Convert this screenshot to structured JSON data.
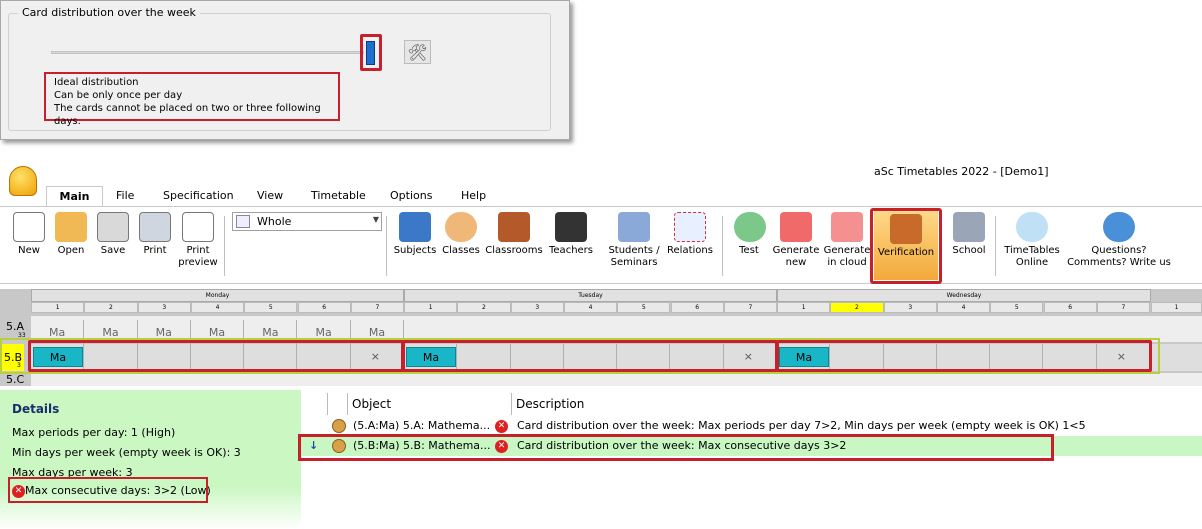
{
  "dialog": {
    "group_title": "Card distribution over the week",
    "description_lines": [
      "Ideal distribution",
      "Can be only once per day",
      "The cards cannot be placed on two or three following days."
    ]
  },
  "app": {
    "title": "aSc Timetables 2022  - [Demo1]"
  },
  "menu": {
    "items": [
      "Main",
      "File",
      "Specification",
      "View",
      "Timetable",
      "Options",
      "Help"
    ]
  },
  "ribbon": {
    "buttons": [
      {
        "label": "New",
        "icon": "new-document-icon"
      },
      {
        "label": "Open",
        "icon": "folder-icon"
      },
      {
        "label": "Save",
        "icon": "save-icon"
      },
      {
        "label": "Print",
        "icon": "print-icon"
      },
      {
        "label": "Print preview",
        "icon": "print-preview-icon"
      },
      {
        "label": "Subjects",
        "icon": "book-icon"
      },
      {
        "label": "Classes",
        "icon": "classes-icon"
      },
      {
        "label": "Classrooms",
        "icon": "door-icon"
      },
      {
        "label": "Teachers",
        "icon": "teacher-icon"
      },
      {
        "label": "Students / Seminars",
        "icon": "students-icon"
      },
      {
        "label": "Relations",
        "icon": "relations-icon"
      },
      {
        "label": "Test",
        "icon": "check-icon"
      },
      {
        "label": "Generate new",
        "icon": "siren-icon"
      },
      {
        "label": "Generate in cloud",
        "icon": "siren-cloud-icon"
      },
      {
        "label": "Verification",
        "icon": "gavel-icon"
      },
      {
        "label": "School",
        "icon": "school-icon"
      },
      {
        "label": "TimeTables Online",
        "icon": "cloud-icon"
      },
      {
        "label": "Questions? Comments? Write us",
        "icon": "question-icon"
      }
    ],
    "view_select": "Whole"
  },
  "grid": {
    "days": [
      "Monday",
      "Tuesday",
      "Wednesday"
    ],
    "periods": [
      "1",
      "2",
      "3",
      "4",
      "5",
      "6",
      "7"
    ],
    "extra_period": "1",
    "rows": [
      {
        "label": "5.A",
        "count": "33",
        "cells": [
          "Ma",
          "Ma",
          "Ma",
          "Ma",
          "Ma",
          "Ma",
          "Ma"
        ]
      },
      {
        "label": "5.B",
        "count": "3",
        "card": "Ma",
        "x": "×"
      },
      {
        "label": "5.C"
      }
    ]
  },
  "details": {
    "title": "Details",
    "lines": [
      "Max periods per day: 1 (High)",
      "Min days per week (empty week is OK): 3",
      "Max days per week: 3"
    ],
    "error_line": "Max consecutive days: 3>2 (Low)"
  },
  "list": {
    "headers": [
      "Object",
      "Description"
    ],
    "rows": [
      {
        "object": "(5.A:Ma) 5.A: Mathema...",
        "description": "Card distribution over the week: Max periods per day 7>2, Min days per week (empty week is OK) 1<5"
      },
      {
        "object": "(5.B:Ma) 5.B: Mathema...",
        "description": "Card distribution over the week: Max consecutive days 3>2",
        "arrow": "↓"
      }
    ]
  },
  "colors": {
    "accent_red": "#c8202a",
    "card": "#19b6c7",
    "selected_row": "#c8f7c3",
    "verify": "#f6b84a"
  }
}
